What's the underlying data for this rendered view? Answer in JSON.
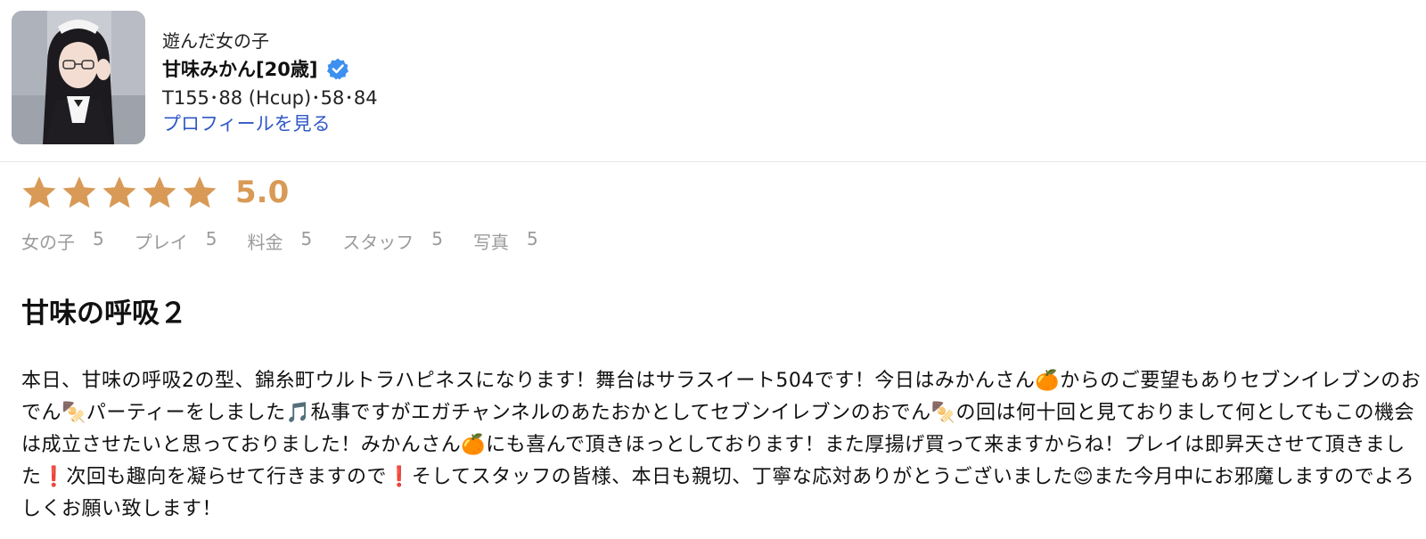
{
  "profile": {
    "section_label": "遊んだ女の子",
    "name": "甘味みかん[20歳]",
    "measurements": "T155･88 (Hcup)･58･84",
    "profile_link": "プロフィールを見る",
    "avatar_alt_icon": "avatar-photo",
    "verified_icon": "verified-badge-icon"
  },
  "rating": {
    "stars": 5,
    "score": "5.0",
    "star_color": "#d89a56",
    "subratings": [
      {
        "label": "女の子",
        "value": "5"
      },
      {
        "label": "プレイ",
        "value": "5"
      },
      {
        "label": "料金",
        "value": "5"
      },
      {
        "label": "スタッフ",
        "value": "5"
      },
      {
        "label": "写真",
        "value": "5"
      }
    ]
  },
  "review": {
    "title": "甘味の呼吸２",
    "body": "本日、甘味の呼吸2の型、錦糸町ウルトラハピネスになります！舞台はサラスイート504です！今日はみかんさん🍊からのご要望もありセブンイレブンのおでん🍢パーティーをしました🎵私事ですがエガチャンネルのあたおかとしてセブンイレブンのおでん🍢の回は何十回と見ておりまして何としてもこの機会は成立させたいと思っておりました！みかんさん🍊にも喜んで頂きほっとしております！また厚揚げ買って来ますからね！プレイは即昇天させて頂きました❗️次回も趣向を凝らせて行きますので❗️そしてスタッフの皆様、本日も親切、丁寧な応対ありがとうございました😊また今月中にお邪魔しますのでよろしくお願い致します！"
  },
  "colors": {
    "link": "#2f58c8",
    "verified": "#3d8ff0",
    "muted": "#9b9b9b"
  }
}
